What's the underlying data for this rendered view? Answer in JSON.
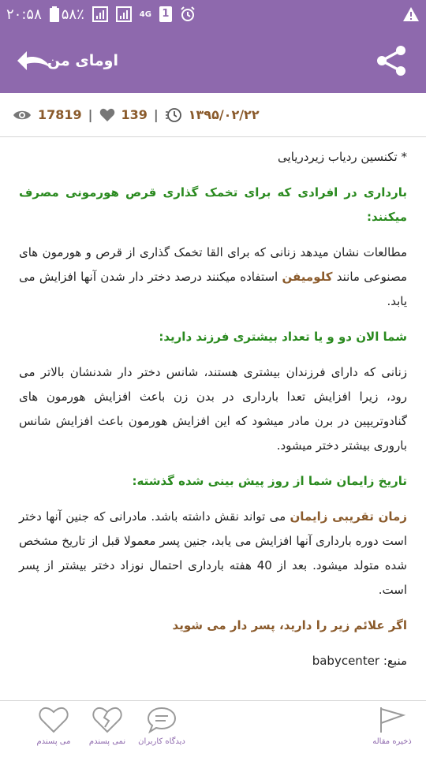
{
  "status_bar": {
    "time": "۲۰:۵۸",
    "battery": "۵۸٪",
    "network": "4G",
    "sim": "1"
  },
  "appbar": {
    "title": "اومای من"
  },
  "meta": {
    "views": "17819",
    "likes": "139",
    "date": "۱۳۹۵/۰۲/۲۲"
  },
  "article": {
    "l1": "* تکنسین ردیاب زیردریایی",
    "h1": "بارداری در افرادی که برای تخمک گذاری قرص هورمونی مصرف میکنند:",
    "p1_a": "مطالعات نشان میدهد زنانی که برای القا تخمک گذاری از قرص و هورمون های مصنوعی مانند ",
    "p1_b": "کلومیفن",
    "p1_c": " استفاده میکنند درصد دختر دار شدن آنها افزایش می یابد.",
    "h2": "شما الان دو و یا تعداد بیشتری فرزند دارید:",
    "p2": "زنانی که دارای فرزندان بیشتری هستند، شانس دختر دار شدنشان بالاتر می رود، زیرا افزایش تعدا بارداری در بدن زن باعث افزایش هورمون های گنادوتریپین در برن مادر میشود که این افزایش هورمون باعث افزایش شانس باروری بیشتر دختر میشود.",
    "h3": "تاریخ زایمان شما از روز پیش بینی شده گذشته:",
    "p3_a": "زمان تقریبی زایمان",
    "p3_b": " می تواند نقش داشته باشد. مادرانی که جنین آنها دختر است دوره بارداری آنها افزایش می یابد، جنین پسر معمولا قبل از تاریخ مشخص شده متولد میشود. بعد از ",
    "p3_num": "40",
    "p3_c": " هفته بارداری احتمال نوزاد دختر بیشتر از پسر است.",
    "h4": "اگر علائم زیر را دارید، پسر دار می شوید",
    "source_label": "منبع:",
    "source_value": "babycenter"
  },
  "bottom_bar": {
    "save": "ذخیره مقاله",
    "comments": "دیدگاه کاربران",
    "dislike": "نمی پسندم",
    "like": "می پسندم"
  },
  "colors": {
    "primary": "#8e69ad",
    "heading_green": "#2a8a1f",
    "accent_brown": "#8a5a2b"
  }
}
